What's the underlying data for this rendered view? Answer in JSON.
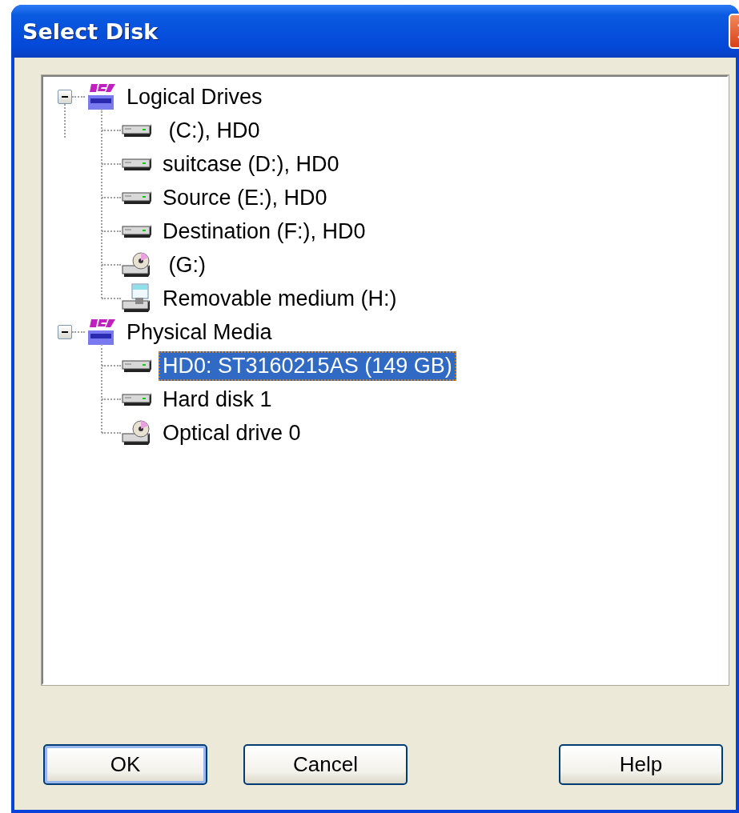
{
  "window": {
    "title": "Select Disk"
  },
  "tree": [
    {
      "label": "Logical Drives",
      "kind": "group",
      "expanded": true,
      "selected": false,
      "children": [
        {
          "label": " (C:), HD0",
          "kind": "hdd",
          "selected": false
        },
        {
          "label": "suitcase (D:), HD0",
          "kind": "hdd",
          "selected": false
        },
        {
          "label": "Source (E:), HD0",
          "kind": "hdd",
          "selected": false
        },
        {
          "label": "Destination (F:), HD0",
          "kind": "hdd",
          "selected": false
        },
        {
          "label": " (G:)",
          "kind": "optical",
          "selected": false
        },
        {
          "label": "Removable medium (H:)",
          "kind": "removable",
          "selected": false
        }
      ]
    },
    {
      "label": "Physical Media",
      "kind": "group",
      "expanded": true,
      "selected": false,
      "children": [
        {
          "label": "HD0: ST3160215AS (149 GB)",
          "kind": "hdd",
          "selected": true
        },
        {
          "label": "Hard disk 1",
          "kind": "hdd",
          "selected": false
        },
        {
          "label": "Optical drive 0",
          "kind": "optical",
          "selected": false
        }
      ]
    }
  ],
  "buttons": [
    {
      "label": "OK",
      "default": true
    },
    {
      "label": "Cancel",
      "default": false
    },
    {
      "label": "Help",
      "default": false
    }
  ]
}
